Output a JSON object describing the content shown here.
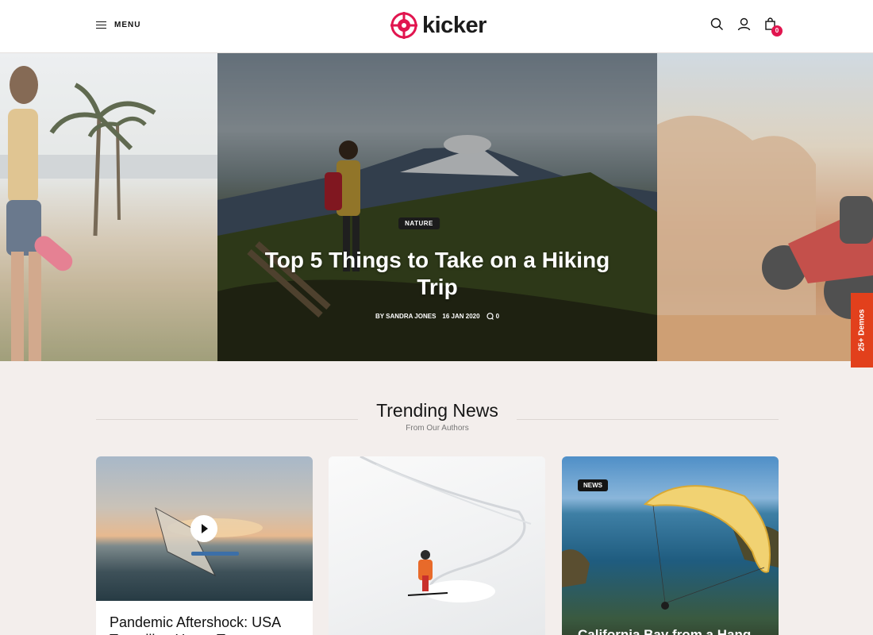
{
  "header": {
    "menu_label": "MENU",
    "logo_text": "kicker",
    "cart_count": "0"
  },
  "hero": {
    "tag": "NATURE",
    "title": "Top 5 Things to Take on a Hiking Trip",
    "author": "BY SANDRA JONES",
    "date": "16 JAN 2020",
    "comments": "0"
  },
  "side_tab": {
    "label": "25+ Demos"
  },
  "trending": {
    "title": "Trending News",
    "subtitle": "From Our Authors",
    "cards": [
      {
        "title": "Pandemic Aftershock: USA Travelling Hours To..."
      },
      {
        "title": ""
      },
      {
        "badge": "NEWS",
        "title": "California Bay from a Hang"
      }
    ]
  },
  "colors": {
    "accent": "#e1154f",
    "tab": "#e2401c",
    "background": "#f3eeec"
  }
}
